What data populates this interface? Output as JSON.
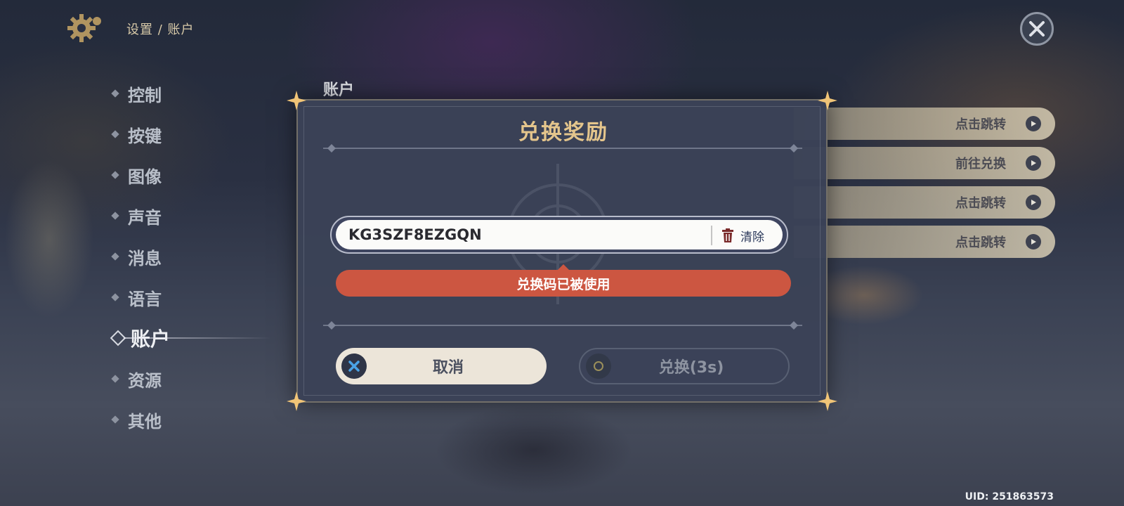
{
  "header": {
    "breadcrumb": "设置 / 账户",
    "settings_icon": "gear-icon",
    "close_icon": "close-icon"
  },
  "sidebar": {
    "items": [
      {
        "label": "控制",
        "active": false
      },
      {
        "label": "按键",
        "active": false
      },
      {
        "label": "图像",
        "active": false
      },
      {
        "label": "声音",
        "active": false
      },
      {
        "label": "消息",
        "active": false
      },
      {
        "label": "语言",
        "active": false
      },
      {
        "label": "账户",
        "active": true
      },
      {
        "label": "资源",
        "active": false
      },
      {
        "label": "其他",
        "active": false
      }
    ]
  },
  "main": {
    "section_label": "账户",
    "link_buttons": [
      {
        "label": "点击跳转"
      },
      {
        "label": "前往兑换"
      },
      {
        "label": "点击跳转"
      },
      {
        "label": "点击跳转"
      }
    ]
  },
  "dialog": {
    "title": "兑换奖励",
    "code_value": "KG3SZF8EZGQN",
    "clear_label": "清除",
    "error_message": "兑换码已被使用",
    "cancel_label": "取消",
    "confirm_label": "兑换(3s)",
    "colors": {
      "title": "#e4c58c",
      "error": "#cc5641",
      "panel": "#3b4257"
    }
  },
  "footer": {
    "uid": "UID: 251863573"
  }
}
